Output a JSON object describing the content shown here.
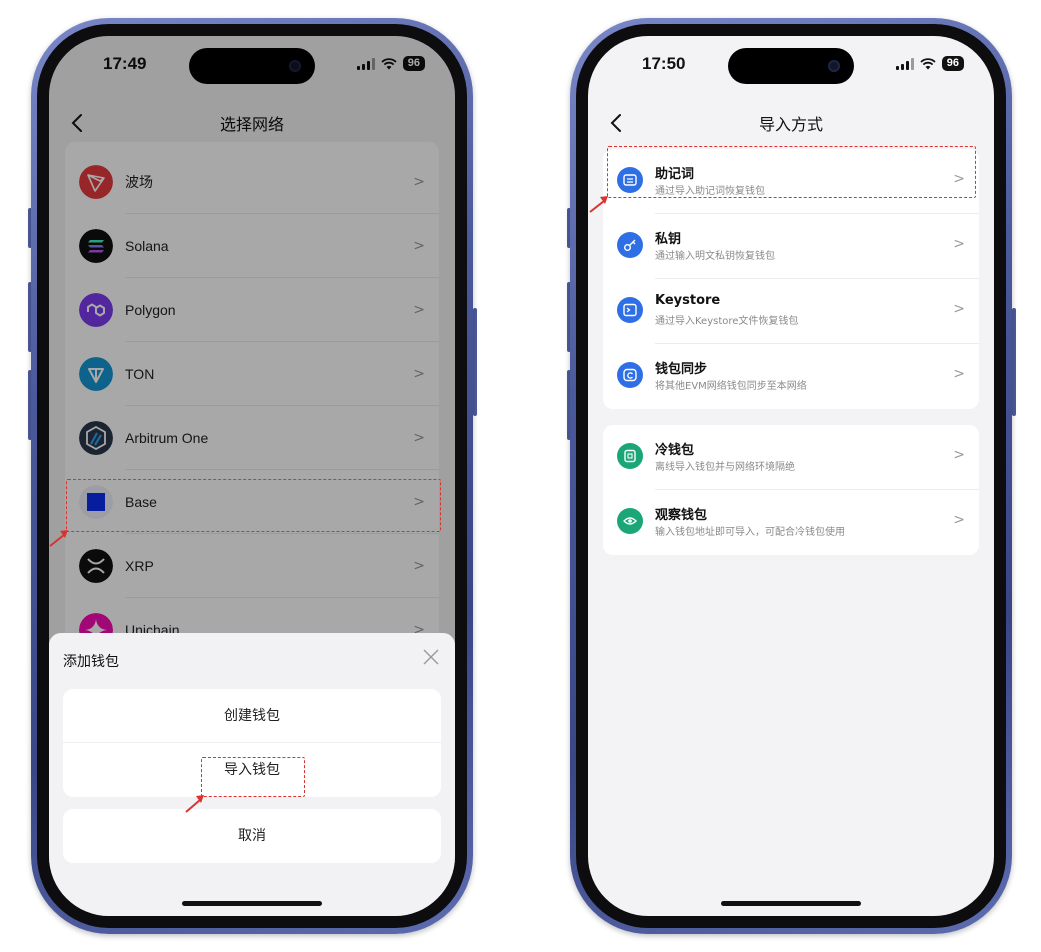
{
  "colors": {
    "highlight": "#d9322f",
    "accent_blue": "#2f6fe6",
    "accent_green": "#1aa676"
  },
  "left": {
    "status": {
      "time": "17:49",
      "battery": "96"
    },
    "nav": {
      "back_icon": "chevron-left-icon",
      "title": "选择网络"
    },
    "networks": [
      {
        "name": "波场",
        "icon": "tron-icon"
      },
      {
        "name": "Solana",
        "icon": "solana-icon"
      },
      {
        "name": "Polygon",
        "icon": "polygon-icon"
      },
      {
        "name": "TON",
        "icon": "ton-icon"
      },
      {
        "name": "Arbitrum One",
        "icon": "arbitrum-icon"
      },
      {
        "name": "Base",
        "icon": "base-icon"
      },
      {
        "name": "XRP",
        "icon": "xrp-icon"
      },
      {
        "name": "Unichain",
        "icon": "unichain-icon"
      }
    ],
    "sheet": {
      "title": "添加钱包",
      "create": "创建钱包",
      "import": "导入钱包",
      "cancel": "取消"
    }
  },
  "right": {
    "status": {
      "time": "17:50",
      "battery": "96"
    },
    "nav": {
      "back_icon": "chevron-left-icon",
      "title": "导入方式"
    },
    "methods": [
      {
        "title": "助记词",
        "subtitle": "通过导入助记词恢复钱包",
        "icon": "mnemonic-icon"
      },
      {
        "title": "私钥",
        "subtitle": "通过输入明文私钥恢复钱包",
        "icon": "key-icon"
      },
      {
        "title": "Keystore",
        "subtitle": "通过导入Keystore文件恢复钱包",
        "icon": "keystore-icon"
      },
      {
        "title": "钱包同步",
        "subtitle": "将其他EVM网络钱包同步至本网络",
        "icon": "sync-icon"
      }
    ],
    "other_methods": [
      {
        "title": "冷钱包",
        "subtitle": "离线导入钱包并与网络环境隔绝",
        "icon": "cold-wallet-icon"
      },
      {
        "title": "观察钱包",
        "subtitle": "输入钱包地址即可导入，可配合冷钱包使用",
        "icon": "eye-icon"
      }
    ]
  }
}
